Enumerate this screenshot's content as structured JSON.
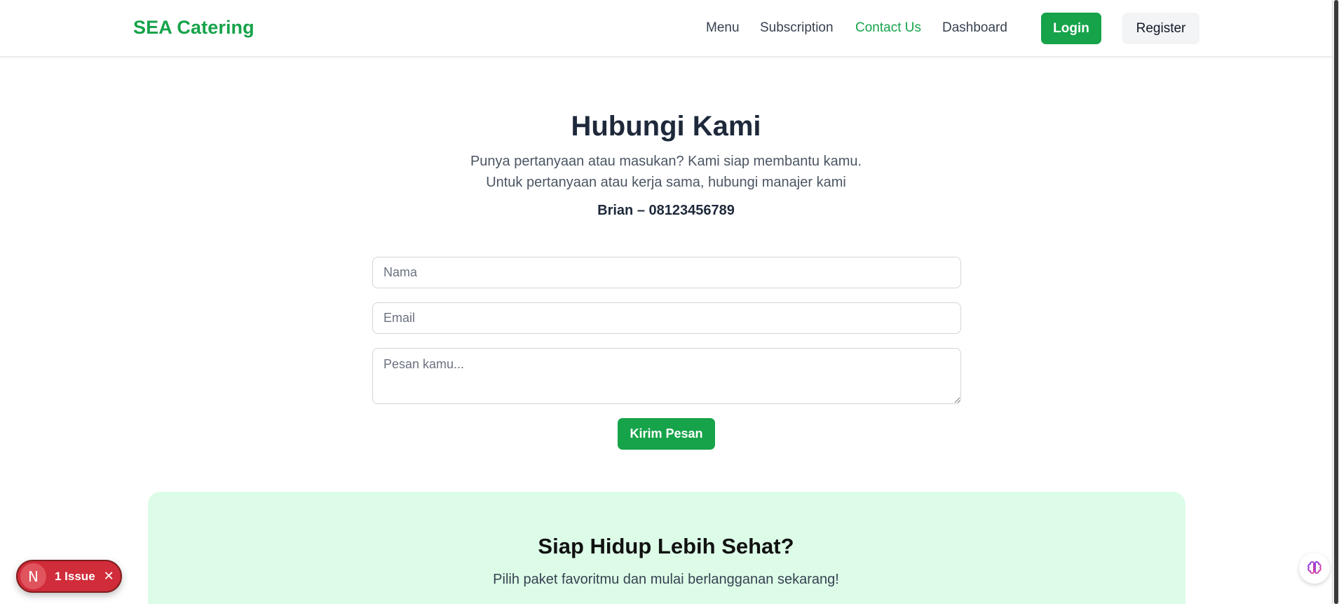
{
  "header": {
    "brand": "SEA Catering",
    "nav": [
      {
        "label": "Menu",
        "active": false
      },
      {
        "label": "Subscription",
        "active": false
      },
      {
        "label": "Contact Us",
        "active": true
      },
      {
        "label": "Dashboard",
        "active": false
      }
    ],
    "login_label": "Login",
    "register_label": "Register"
  },
  "contact": {
    "title": "Hubungi Kami",
    "subtitle_1": "Punya pertanyaan atau masukan? Kami siap membantu kamu.",
    "subtitle_2": "Untuk pertanyaan atau kerja sama, hubungi manajer kami",
    "manager_line": "Brian – 08123456789",
    "form": {
      "name_placeholder": "Nama",
      "email_placeholder": "Email",
      "message_placeholder": "Pesan kamu...",
      "submit_label": "Kirim Pesan"
    }
  },
  "cta": {
    "title": "Siap Hidup Lebih Sehat?",
    "subtitle": "Pilih paket favoritmu dan mulai berlangganan sekarang!"
  },
  "dev_overlay": {
    "logo_letter": "N",
    "issue_text": "1 Issue",
    "close_glyph": "✕"
  },
  "colors": {
    "brand_green": "#16a34a",
    "cta_background": "#dcfce7",
    "issue_red": "#d02c3a"
  }
}
